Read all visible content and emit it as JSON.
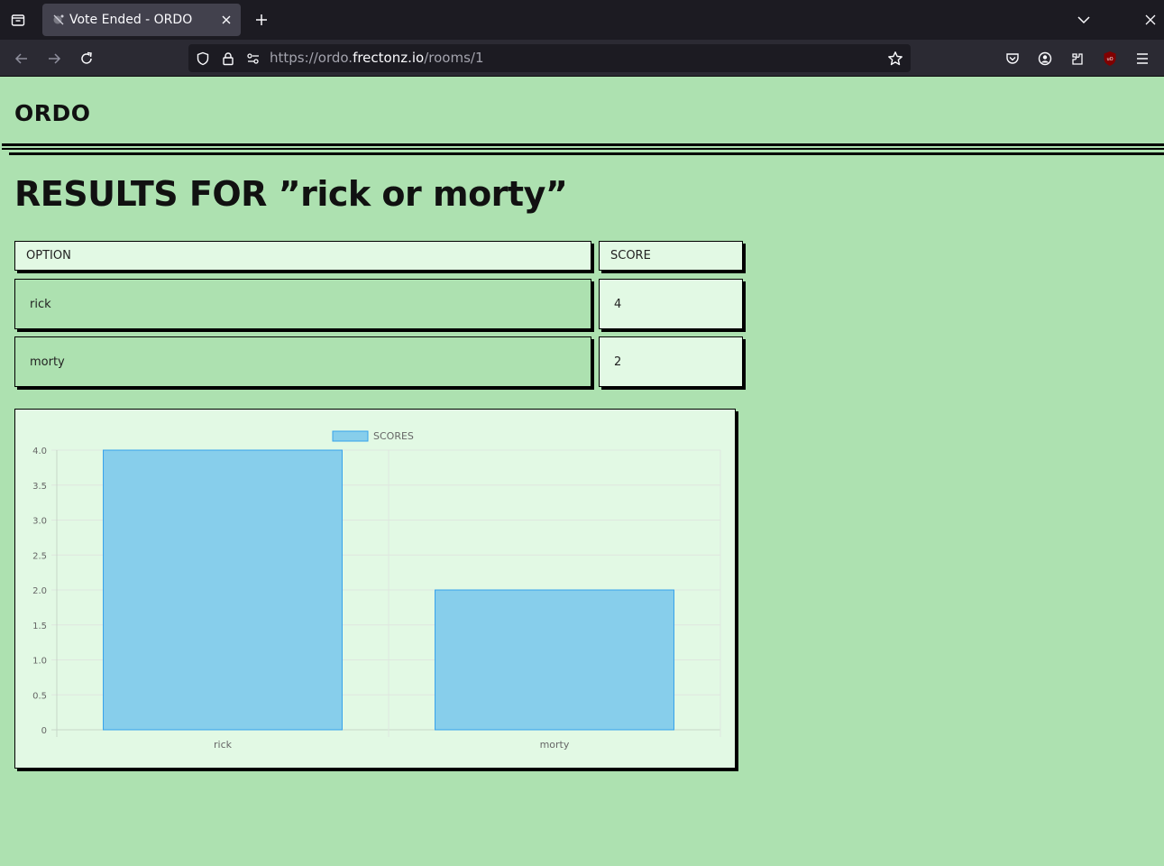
{
  "browser": {
    "tab_title": "Vote Ended - ORDO",
    "url_prefix": "https://ordo.",
    "url_host": "frectonz.io",
    "url_path": "/rooms/1"
  },
  "app": {
    "logo": "ORDO",
    "heading": "RESULTS FOR ”rick or morty”"
  },
  "table": {
    "headers": {
      "option": "OPTION",
      "score": "SCORE"
    },
    "rows": [
      {
        "option": "rick",
        "score": "4"
      },
      {
        "option": "morty",
        "score": "2"
      }
    ]
  },
  "chart_data": {
    "type": "bar",
    "categories": [
      "rick",
      "morty"
    ],
    "series": [
      {
        "name": "SCORES",
        "values": [
          4,
          2
        ]
      }
    ],
    "ylim": [
      0,
      4
    ],
    "yticks": [
      "0",
      "0.5",
      "1.0",
      "1.5",
      "2.0",
      "2.5",
      "3.0",
      "3.5",
      "4.0"
    ],
    "legend": "top-center",
    "grid": true,
    "bar_color": "#87ceeb",
    "bar_border": "#36a2eb"
  }
}
